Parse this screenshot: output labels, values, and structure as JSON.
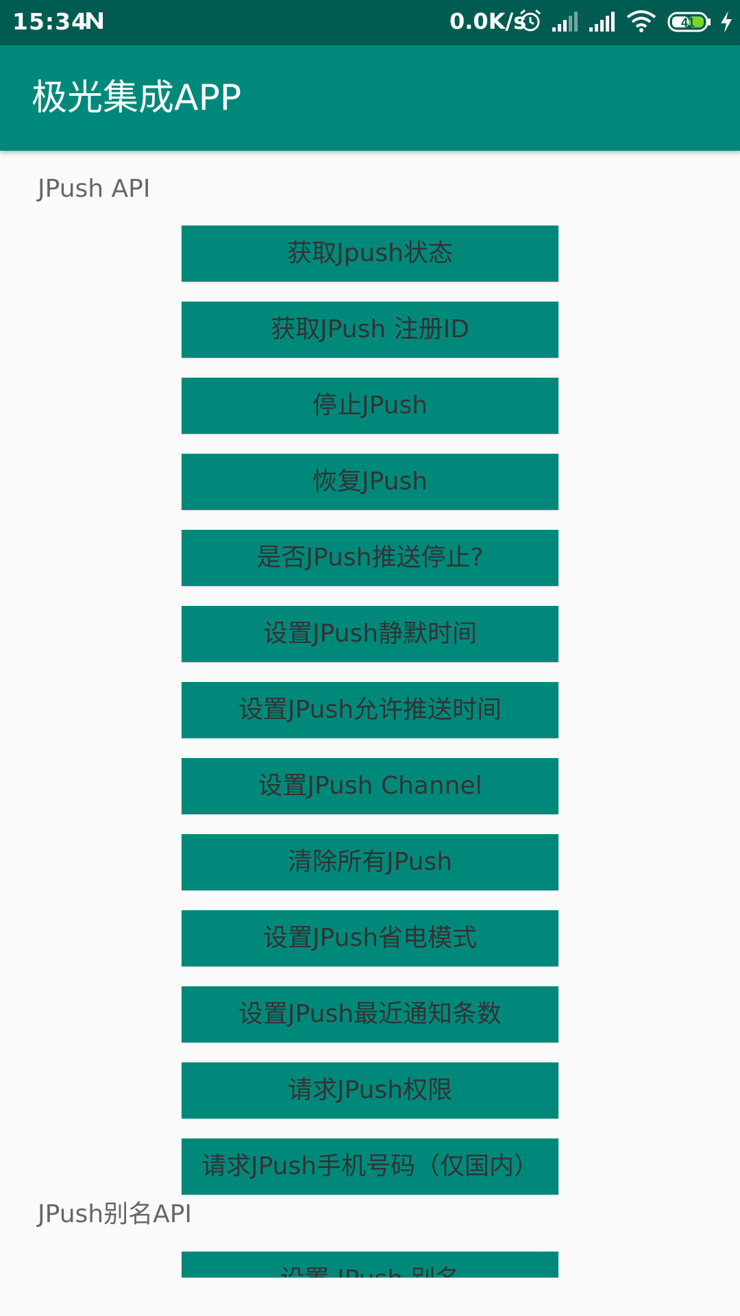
{
  "status_bar": {
    "time": "15:34",
    "net_speed": "0.0K/s",
    "battery": "41",
    "icons": [
      "n-notification-icon",
      "alarm-icon",
      "signal-icon",
      "signal-icon",
      "wifi-icon",
      "battery-icon",
      "charging-icon"
    ]
  },
  "app_bar": {
    "title": "极光集成APP"
  },
  "sections": [
    {
      "label": "JPush API"
    },
    {
      "label": "JPush别名API"
    }
  ],
  "buttons": [
    "获取Jpush状态",
    "获取JPush 注册ID",
    "停止JPush",
    "恢复JPush",
    "是否JPush推送停止?",
    "设置JPush静默时间",
    "设置JPush允许推送时间",
    "设置JPush Channel",
    "清除所有JPush",
    "设置JPush省电模式",
    "设置JPush最近通知条数",
    "请求JPush权限",
    "请求JPush手机号码（仅国内）"
  ],
  "alias_buttons": [
    "设置 JPush 别名"
  ],
  "colors": {
    "status_bar": "#005c50",
    "primary": "#00897b",
    "background": "#fafafa",
    "button_text": "#333333",
    "section_text": "#666666"
  }
}
